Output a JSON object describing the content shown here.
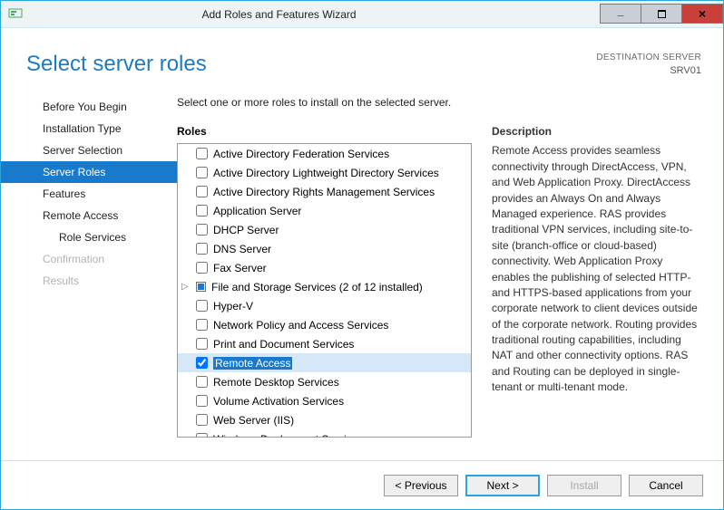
{
  "window": {
    "title": "Add Roles and Features Wizard",
    "minimize": "–",
    "maximize": "□",
    "close": "x"
  },
  "header": {
    "page_title": "Select server roles",
    "destination_label": "DESTINATION SERVER",
    "destination_value": "SRV01"
  },
  "nav": {
    "items": [
      {
        "label": "Before You Begin",
        "state": "normal"
      },
      {
        "label": "Installation Type",
        "state": "normal"
      },
      {
        "label": "Server Selection",
        "state": "normal"
      },
      {
        "label": "Server Roles",
        "state": "selected"
      },
      {
        "label": "Features",
        "state": "normal"
      },
      {
        "label": "Remote Access",
        "state": "normal"
      },
      {
        "label": "Role Services",
        "state": "sub"
      },
      {
        "label": "Confirmation",
        "state": "disabled"
      },
      {
        "label": "Results",
        "state": "disabled"
      }
    ]
  },
  "main": {
    "instruction": "Select one or more roles to install on the selected server.",
    "roles_label": "Roles",
    "roles": [
      {
        "label": "Active Directory Federation Services",
        "checked": false
      },
      {
        "label": "Active Directory Lightweight Directory Services",
        "checked": false
      },
      {
        "label": "Active Directory Rights Management Services",
        "checked": false
      },
      {
        "label": "Application Server",
        "checked": false
      },
      {
        "label": "DHCP Server",
        "checked": false
      },
      {
        "label": "DNS Server",
        "checked": false
      },
      {
        "label": "Fax Server",
        "checked": false
      },
      {
        "label": "File and Storage Services (2 of 12 installed)",
        "checked": "partial",
        "expander": true
      },
      {
        "label": "Hyper-V",
        "checked": false
      },
      {
        "label": "Network Policy and Access Services",
        "checked": false
      },
      {
        "label": "Print and Document Services",
        "checked": false
      },
      {
        "label": "Remote Access",
        "checked": true,
        "highlight": true
      },
      {
        "label": "Remote Desktop Services",
        "checked": false
      },
      {
        "label": "Volume Activation Services",
        "checked": false
      },
      {
        "label": "Web Server (IIS)",
        "checked": false
      },
      {
        "label": "Windows Deployment Services",
        "checked": false
      }
    ],
    "description_label": "Description",
    "description_text": "Remote Access provides seamless connectivity through DirectAccess, VPN, and Web Application Proxy. DirectAccess provides an Always On and Always Managed experience. RAS provides traditional VPN services, including site-to-site (branch-office or cloud-based) connectivity. Web Application Proxy enables the publishing of selected HTTP- and HTTPS-based applications from your corporate network to client devices outside of the corporate network. Routing provides traditional routing capabilities, including NAT and other connectivity options. RAS and Routing can be deployed in single-tenant or multi-tenant mode."
  },
  "footer": {
    "previous": "< Previous",
    "next": "Next >",
    "install": "Install",
    "cancel": "Cancel"
  }
}
